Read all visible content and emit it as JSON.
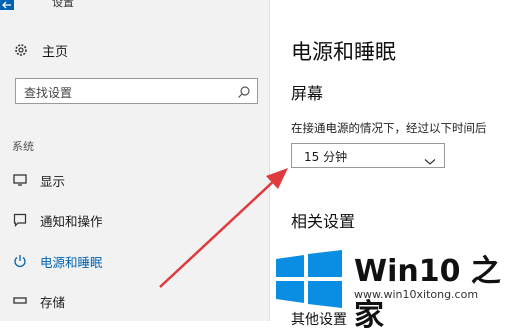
{
  "window": {
    "title": "设置"
  },
  "sidebar": {
    "home_label": "主页",
    "search_placeholder": "查找设置",
    "section_label": "系统",
    "items": [
      {
        "label": "显示",
        "icon": "monitor-icon",
        "active": false
      },
      {
        "label": "通知和操作",
        "icon": "message-icon",
        "active": false
      },
      {
        "label": "电源和睡眠",
        "icon": "power-icon",
        "active": true
      },
      {
        "label": "存储",
        "icon": "storage-icon",
        "active": false
      }
    ]
  },
  "main": {
    "title": "电源和睡眠",
    "screen_heading": "屏幕",
    "screen_desc": "在接通电源的情况下，经过以下时间后",
    "screen_timeout_value": "15 分钟",
    "related_heading": "相关设置",
    "cut_off_text": "其他设置"
  },
  "watermark": {
    "title": "Win10 之家",
    "url": "www.win10xitong.com"
  },
  "colors": {
    "accent": "#0063b1",
    "sidebar_bg": "#f2f2f2",
    "arrow": "#e0393e",
    "logo_blue": "#0a8ee3"
  }
}
